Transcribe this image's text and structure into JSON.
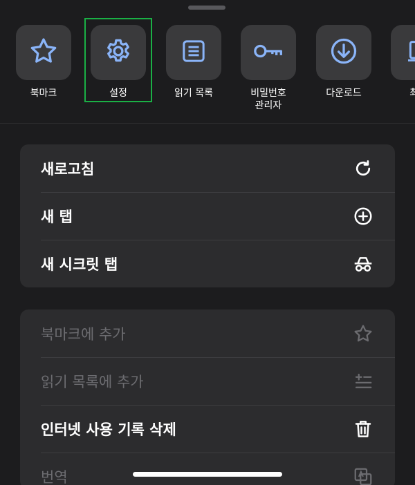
{
  "tray": {
    "items": [
      {
        "label": "북마크",
        "icon": "star-icon"
      },
      {
        "label": "설정",
        "icon": "gear-icon"
      },
      {
        "label": "읽기 목록",
        "icon": "list-icon"
      },
      {
        "label": "비밀번호\n관리자",
        "icon": "key-icon"
      },
      {
        "label": "다운로드",
        "icon": "download-icon"
      },
      {
        "label": "최근",
        "icon": "history-icon"
      }
    ]
  },
  "menu1": {
    "items": [
      {
        "label": "새로고침",
        "icon": "reload-icon"
      },
      {
        "label": "새 탭",
        "icon": "plus-circle-icon"
      },
      {
        "label": "새 시크릿 탭",
        "icon": "incognito-icon"
      }
    ]
  },
  "menu2": {
    "items": [
      {
        "label": "북마크에 추가",
        "icon": "star-outline-icon",
        "enabled": false
      },
      {
        "label": "읽기 목록에 추가",
        "icon": "add-list-icon",
        "enabled": false
      },
      {
        "label": "인터넷 사용 기록 삭제",
        "icon": "trash-icon",
        "enabled": true
      },
      {
        "label": "번역",
        "icon": "translate-icon",
        "enabled": false
      }
    ]
  },
  "colors": {
    "accent": "#8ab4f8",
    "background": "#1c1c1e",
    "tile": "#3a3a3c",
    "group": "#2c2c2e",
    "selection_outline": "#1ab045",
    "disabled_text": "#6c6c70"
  }
}
